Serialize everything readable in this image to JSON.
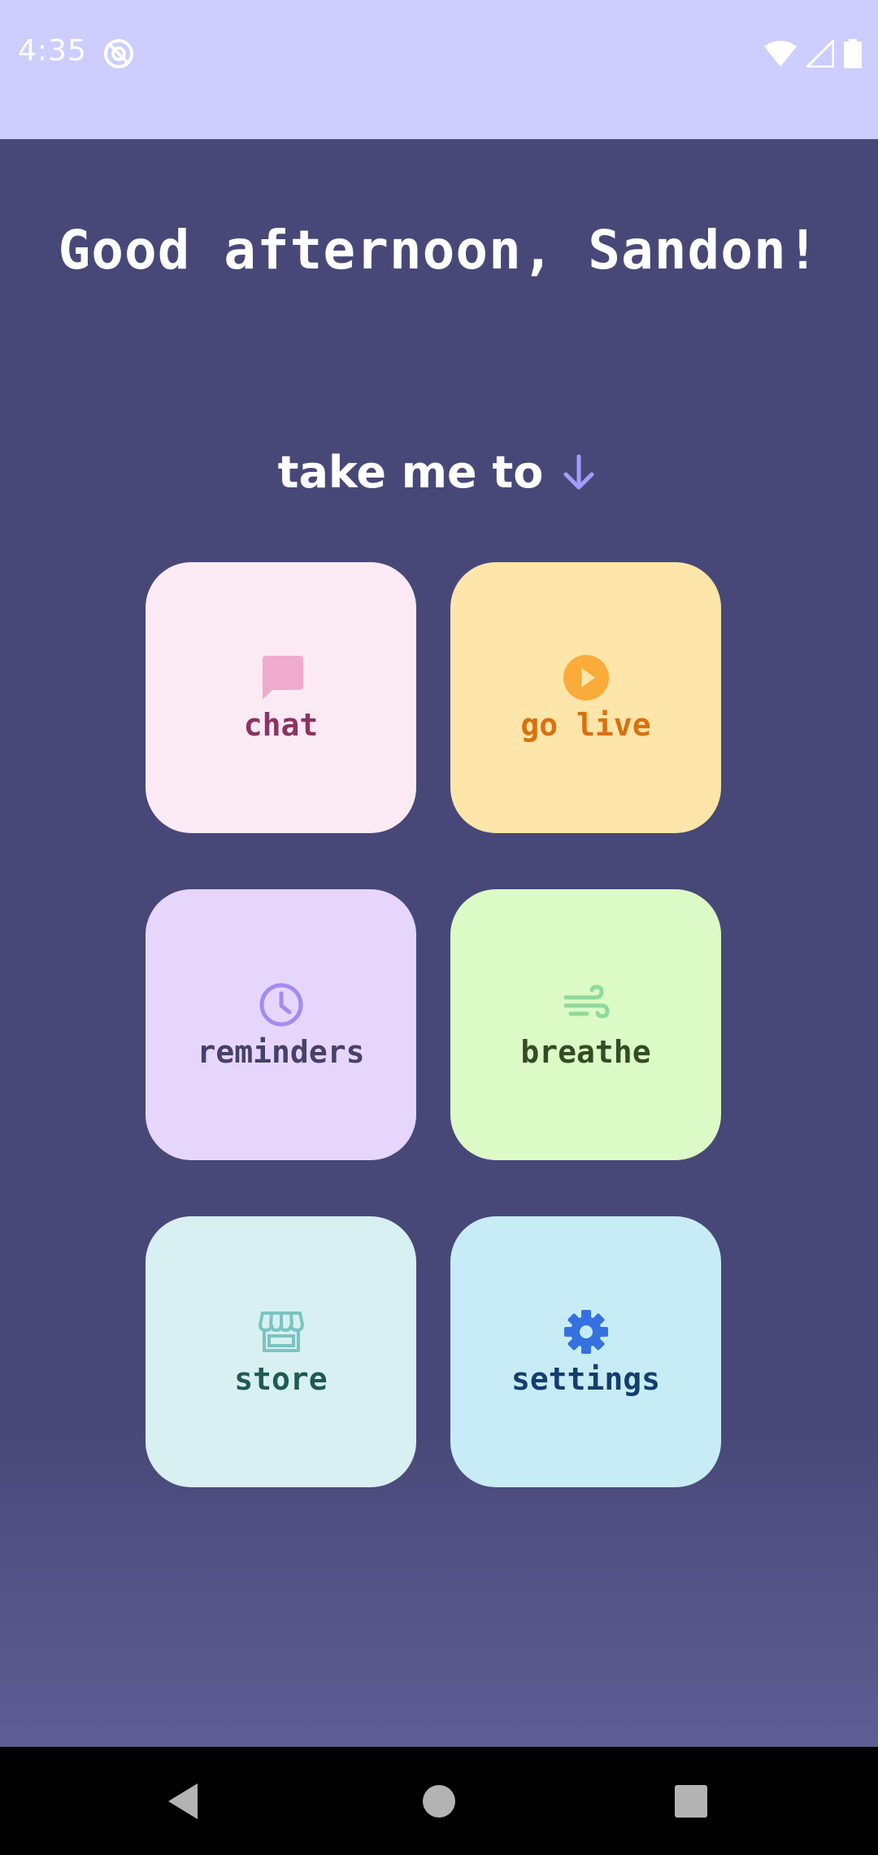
{
  "status_bar": {
    "time": "4:35",
    "background_color": "#cdcdfe",
    "icons": [
      "app-notification-icon",
      "wifi-icon",
      "signal-icon",
      "battery-icon"
    ]
  },
  "greeting": "Good afternoon, Sandon!",
  "take_me_to": {
    "label": "take me to",
    "icon": "arrow-down-icon",
    "icon_color": "#a49cff"
  },
  "tiles": [
    {
      "label": "chat",
      "icon": "chat-bubble-icon",
      "bg": "#fbeaf3",
      "text_color": "#8a3563",
      "icon_color": "#eeabcc"
    },
    {
      "label": "go live",
      "icon": "play-circle-icon",
      "bg": "#fee5a9",
      "text_color": "#d8710f",
      "icon_color": "#fbab3a"
    },
    {
      "label": "reminders",
      "icon": "clock-icon",
      "bg": "#e7d6fc",
      "text_color": "#46416b",
      "icon_color": "#a28cf2"
    },
    {
      "label": "breathe",
      "icon": "wind-icon",
      "bg": "#dcfac5",
      "text_color": "#344c25",
      "icon_color": "#8ed99c"
    },
    {
      "label": "store",
      "icon": "storefront-icon",
      "bg": "#d8f0f1",
      "text_color": "#1f5a54",
      "icon_color": "#7bc4c1"
    },
    {
      "label": "settings",
      "icon": "gear-icon",
      "bg": "#c8ecf5",
      "text_color": "#133e6e",
      "icon_color": "#3571e0"
    }
  ],
  "navigation": {
    "icons": [
      "back-icon",
      "home-icon",
      "recents-icon"
    ]
  },
  "colors": {
    "background": "#484878",
    "greeting_text": "#ffffff"
  }
}
